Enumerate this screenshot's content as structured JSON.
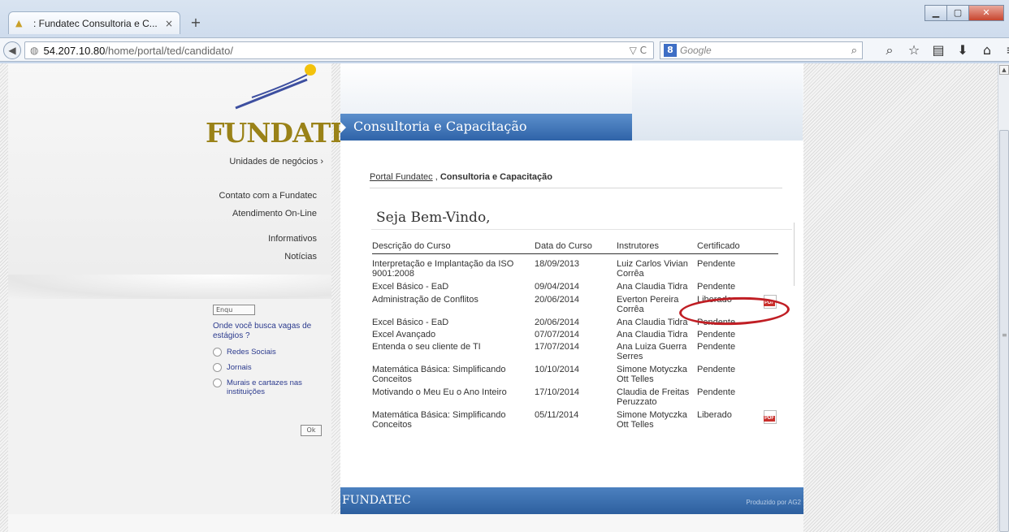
{
  "browser": {
    "tab_title": ": Fundatec Consultoria e C...",
    "tab_close": "×",
    "new_tab": "+",
    "url_host": "54.207.10.80",
    "url_path": "/home/portal/ted/candidato/",
    "search_engine": "8",
    "search_placeholder": "Google",
    "window_buttons": {
      "minimize": "▁",
      "maximize": "▢",
      "close": "✕"
    },
    "toolbar_icons": [
      "search-icon",
      "star-icon",
      "reading-list-icon",
      "download-icon",
      "home-icon",
      "menu-icon"
    ]
  },
  "header": {
    "logo": "FUNDATEC",
    "logo_mark": "®",
    "section_title": "Consultoria e Capacitação"
  },
  "sidebar": {
    "unidades": "Unidades de negócios",
    "unidades_arrow": "›",
    "contato": "Contato com a Fundatec",
    "atendimento": "Atendimento On-Line",
    "informativos": "Informativos",
    "noticias": "Notícias"
  },
  "poll": {
    "badge": "Enqu",
    "question": "Onde você busca vagas de estágios ?",
    "options": [
      "Redes Sociais",
      "Jornais",
      "Murais e cartazes nas instituições"
    ],
    "vote_button": "Ok"
  },
  "breadcrumb": {
    "link": "Portal Fundatec",
    "separator": ",",
    "current": "Consultoria e Capacitação"
  },
  "welcome": "Seja Bem-Vindo,",
  "table": {
    "headers": [
      "Descrição do Curso",
      "Data do Curso",
      "Instrutores",
      "Certificado"
    ],
    "rows": [
      {
        "nome": "Interpretação e Implantação da ISO 9001:2008",
        "data": "18/09/2013",
        "instrutor": "Luiz Carlos Vivian Corrêa",
        "cert": "Pendente",
        "pdf": false
      },
      {
        "nome": "Excel Básico - EaD",
        "data": "09/04/2014",
        "instrutor": "Ana Claudia Tidra",
        "cert": "Pendente",
        "pdf": false
      },
      {
        "nome": "Administração de Conflitos",
        "data": "20/06/2014",
        "instrutor": "Everton Pereira Corrêa",
        "cert": "Liberado",
        "pdf": true
      },
      {
        "nome": "Excel Básico - EaD",
        "data": "20/06/2014",
        "instrutor": "Ana Claudia Tidra",
        "cert": "Pendente",
        "pdf": false
      },
      {
        "nome": "Excel Avançado",
        "data": "07/07/2014",
        "instrutor": "Ana Claudia Tidra",
        "cert": "Pendente",
        "pdf": false
      },
      {
        "nome": "Entenda o seu cliente de TI",
        "data": "17/07/2014",
        "instrutor": "Ana Luiza Guerra Serres",
        "cert": "Pendente",
        "pdf": false
      },
      {
        "nome": "Matemática Básica: Simplificando Conceitos",
        "data": "10/10/2014",
        "instrutor": "Simone Motyczka Ott Telles",
        "cert": "Pendente",
        "pdf": false
      },
      {
        "nome": "Motivando o Meu Eu o Ano Inteiro",
        "data": "17/10/2014",
        "instrutor": "Claudia de Freitas Peruzzato",
        "cert": "Pendente",
        "pdf": false
      },
      {
        "nome": "Matemática Básica: Simplificando Conceitos",
        "data": "05/11/2014",
        "instrutor": "Simone Motyczka Ott Telles",
        "cert": "Liberado",
        "pdf": true
      }
    ],
    "pdf_label": "PDF"
  },
  "footer": {
    "brand": "FUNDATEC",
    "credit": "Produzido por AG2"
  },
  "colors": {
    "header_blue": "#2f63a8",
    "logo_gold": "#9a8218",
    "highlight_red": "#c01e24",
    "poll_text": "#2c3b8e"
  }
}
